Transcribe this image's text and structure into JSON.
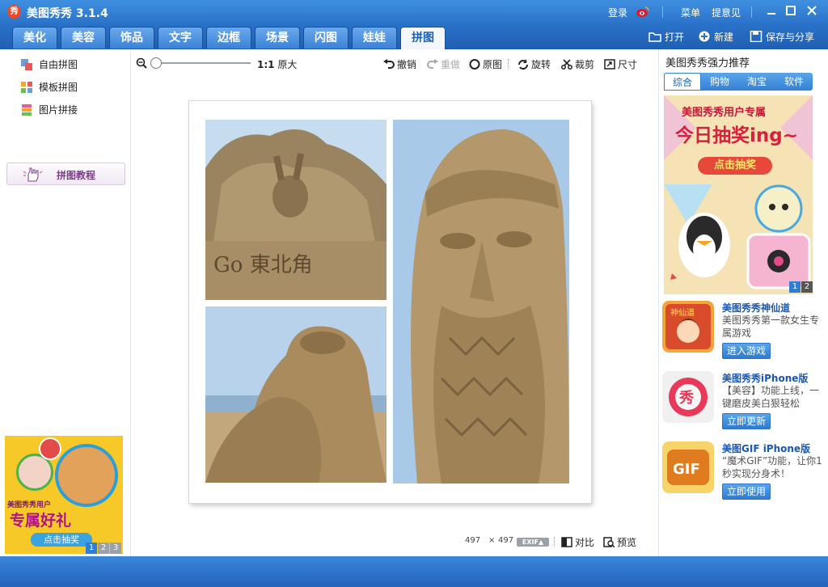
{
  "window": {
    "title": "美图秀秀 3.1.4",
    "logo_text": "秀",
    "login": "登录",
    "menu": "菜单",
    "feedback": "提意见"
  },
  "tabs": [
    {
      "label": "美化",
      "active": false
    },
    {
      "label": "美容",
      "active": false
    },
    {
      "label": "饰品",
      "active": false
    },
    {
      "label": "文字",
      "active": false
    },
    {
      "label": "边框",
      "active": false
    },
    {
      "label": "场景",
      "active": false
    },
    {
      "label": "闪图",
      "active": false
    },
    {
      "label": "娃娃",
      "active": false
    },
    {
      "label": "拼图",
      "active": true
    }
  ],
  "actions": {
    "open": "打开",
    "new": "新建",
    "save_share": "保存与分享"
  },
  "left": {
    "modes": [
      {
        "label": "自由拼图",
        "icon": "free-collage-icon"
      },
      {
        "label": "模板拼图",
        "icon": "template-collage-icon"
      },
      {
        "label": "图片拼接",
        "icon": "image-splice-icon"
      }
    ],
    "tutorial": "拼图教程",
    "promo": {
      "small": "美图秀秀用户",
      "big": "专属好礼",
      "cta": "点击抽奖",
      "pages": [
        "1",
        "2",
        "3"
      ]
    }
  },
  "toolbar": {
    "original_size_prefix": "1:1",
    "original_size": "原大",
    "undo": "撤销",
    "redo": "重做",
    "original": "原图",
    "rotate": "旋转",
    "crop": "裁剪",
    "size": "尺寸"
  },
  "status": {
    "width": "497",
    "times": "×",
    "height": "497",
    "exif": "EXIF▲",
    "compare": "对比",
    "preview": "预览"
  },
  "right": {
    "title": "美图秀秀强力推荐",
    "tabs": [
      {
        "label": "综合",
        "active": true
      },
      {
        "label": "购物",
        "active": false
      },
      {
        "label": "淘宝",
        "active": false
      },
      {
        "label": "软件",
        "active": false
      }
    ],
    "banner": {
      "line1": "美图秀秀用户专属",
      "line2": "今日抽奖ing~",
      "cta": "点击抽奖",
      "pages": [
        "1",
        "2"
      ]
    },
    "apps": [
      {
        "name": "美图秀秀神仙道",
        "desc": "美图秀秀第一款女生专属游戏",
        "button": "进入游戏"
      },
      {
        "name": "美图秀秀iPhone版",
        "desc": "【美容】功能上线，一键磨皮美白狠轻松",
        "button": "立即更新"
      },
      {
        "name": "美图GIF iPhone版",
        "desc": "“魔术GIF”功能，让你1秒实现分身术！",
        "button": "立即使用"
      }
    ]
  },
  "colors": {
    "title_bar": "#2f7dd5",
    "tab_active_text": "#1b5fb5",
    "link_blue": "#1b58b0",
    "sand": "#b59a70"
  }
}
